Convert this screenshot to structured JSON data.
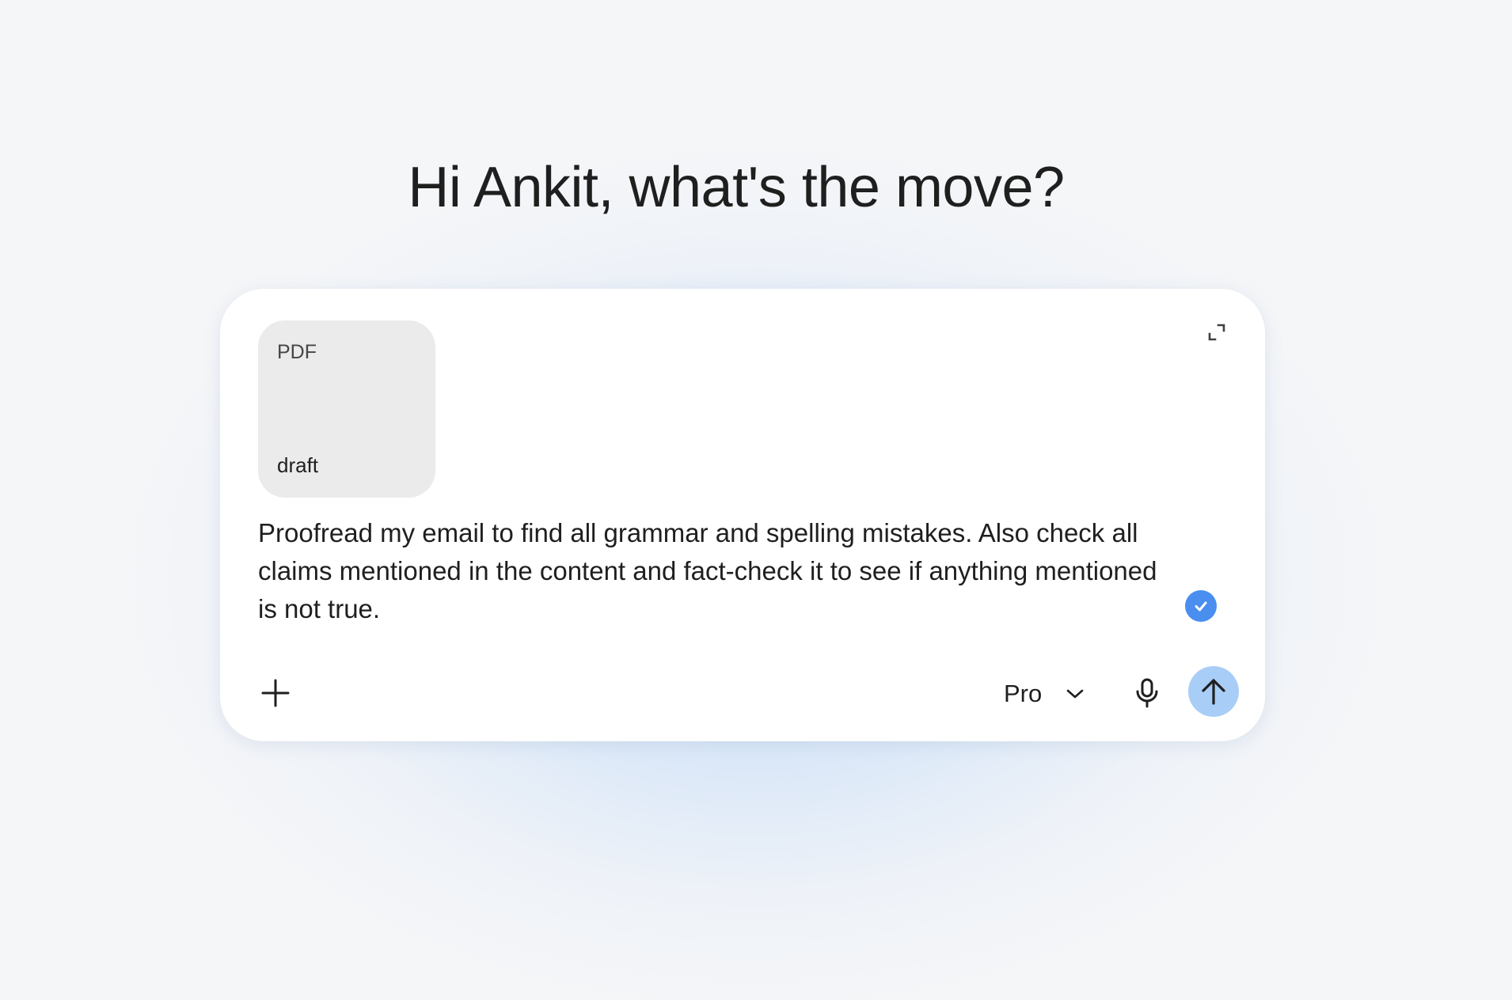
{
  "greeting": "Hi Ankit, what's the move?",
  "attachment": {
    "type": "PDF",
    "name": "draft"
  },
  "prompt": {
    "text": "Proofread my email to find all grammar and spelling mistakes. Also check all claims mentioned in the content and fact-check it to see if anything mentioned is not true."
  },
  "toolbar": {
    "model_label": "Pro",
    "add_icon": "plus-icon",
    "dropdown_icon": "chevron-down-icon",
    "mic_icon": "microphone-icon",
    "send_icon": "arrow-up-icon",
    "expand_icon": "expand-icon",
    "check_icon": "checkmark-icon"
  },
  "colors": {
    "send_button": "#a8cdf7",
    "check_badge": "#4a8ef0",
    "composer_bg": "#ffffff",
    "attachment_bg": "#ebebeb"
  }
}
